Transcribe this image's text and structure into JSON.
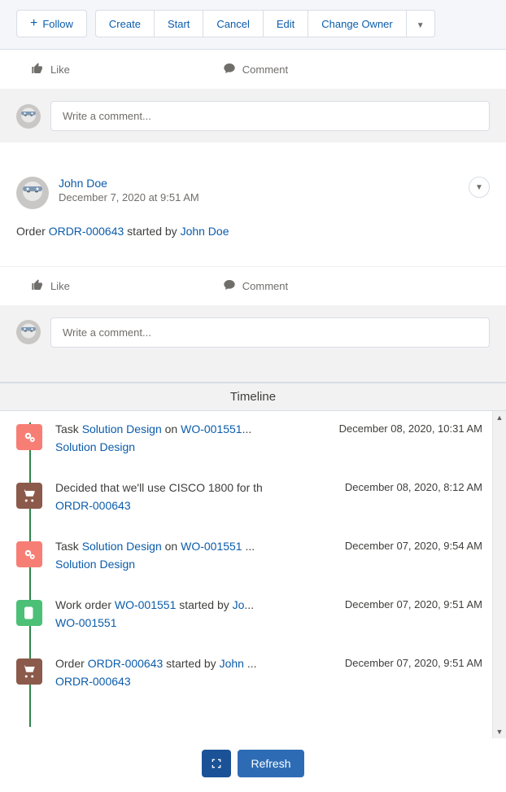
{
  "actions": {
    "follow": "Follow",
    "create": "Create",
    "start": "Start",
    "cancel": "Cancel",
    "edit": "Edit",
    "change_owner": "Change Owner"
  },
  "feed": {
    "like_label": "Like",
    "comment_label": "Comment",
    "comment_placeholder": "Write a comment...",
    "post": {
      "author": "John Doe",
      "date": "December 7, 2020 at 9:51 AM",
      "body_prefix": "Order ",
      "body_link1": "ORDR-000643",
      "body_mid": " started by ",
      "body_link2": "John Doe"
    }
  },
  "timeline": {
    "header": "Timeline",
    "items": [
      {
        "icon": "task",
        "title_pre": "Task ",
        "title_link1": "Solution Design",
        "title_mid": " on ",
        "title_link2": "WO-001551",
        "title_suf": "...",
        "timestamp": "December 08, 2020, 10:31 AM",
        "secondary": "Solution Design"
      },
      {
        "icon": "order",
        "title_pre": "Decided that we'll use CISCO 1800 for th",
        "title_link1": "",
        "title_mid": "",
        "title_link2": "",
        "title_suf": "",
        "timestamp": "December 08, 2020, 8:12 AM",
        "secondary": "ORDR-000643"
      },
      {
        "icon": "task",
        "title_pre": "Task ",
        "title_link1": "Solution Design",
        "title_mid": " on ",
        "title_link2": "WO-001551",
        "title_suf": " ...",
        "timestamp": "December 07, 2020, 9:54 AM",
        "secondary": "Solution Design"
      },
      {
        "icon": "wo",
        "title_pre": "Work order ",
        "title_link1": "WO-001551",
        "title_mid": " started by ",
        "title_link2": "Jo",
        "title_suf": "...",
        "timestamp": "December 07, 2020, 9:51 AM",
        "secondary": "WO-001551"
      },
      {
        "icon": "order",
        "title_pre": "Order ",
        "title_link1": "ORDR-000643",
        "title_mid": " started by ",
        "title_link2": "John ",
        "title_suf": "...",
        "timestamp": "December 07, 2020, 9:51 AM",
        "secondary": "ORDR-000643"
      }
    ]
  },
  "bottom": {
    "refresh": "Refresh"
  }
}
